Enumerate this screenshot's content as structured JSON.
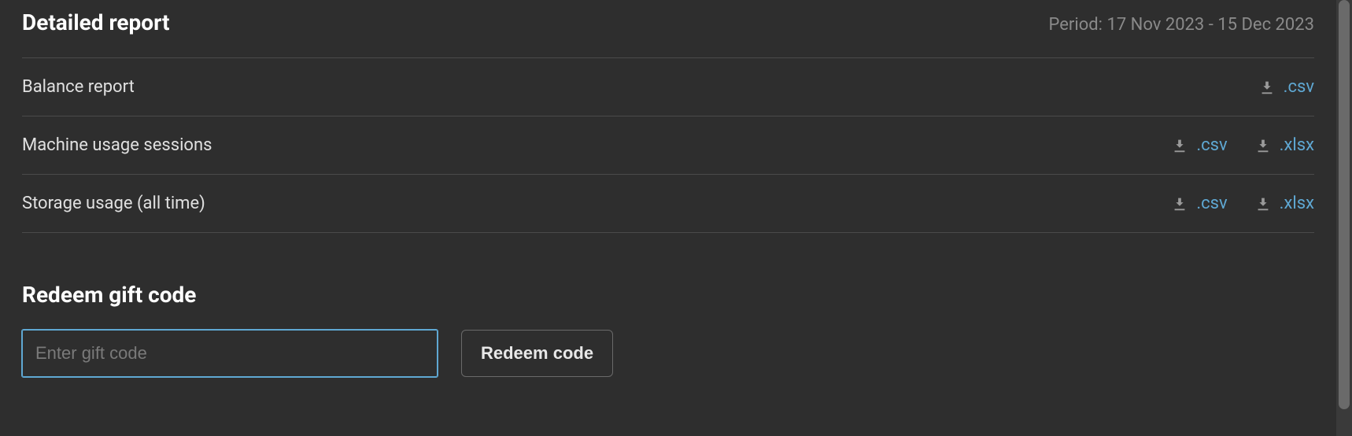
{
  "detailed_report": {
    "title": "Detailed report",
    "period": "Period: 17 Nov 2023 - 15 Dec 2023",
    "rows": [
      {
        "label": "Balance report",
        "downloads": [
          {
            "ext": ".csv"
          }
        ]
      },
      {
        "label": "Machine usage sessions",
        "downloads": [
          {
            "ext": ".csv"
          },
          {
            "ext": ".xlsx"
          }
        ]
      },
      {
        "label": "Storage usage (all time)",
        "downloads": [
          {
            "ext": ".csv"
          },
          {
            "ext": ".xlsx"
          }
        ]
      }
    ]
  },
  "redeem": {
    "title": "Redeem gift code",
    "placeholder": "Enter gift code",
    "button_label": "Redeem code"
  }
}
